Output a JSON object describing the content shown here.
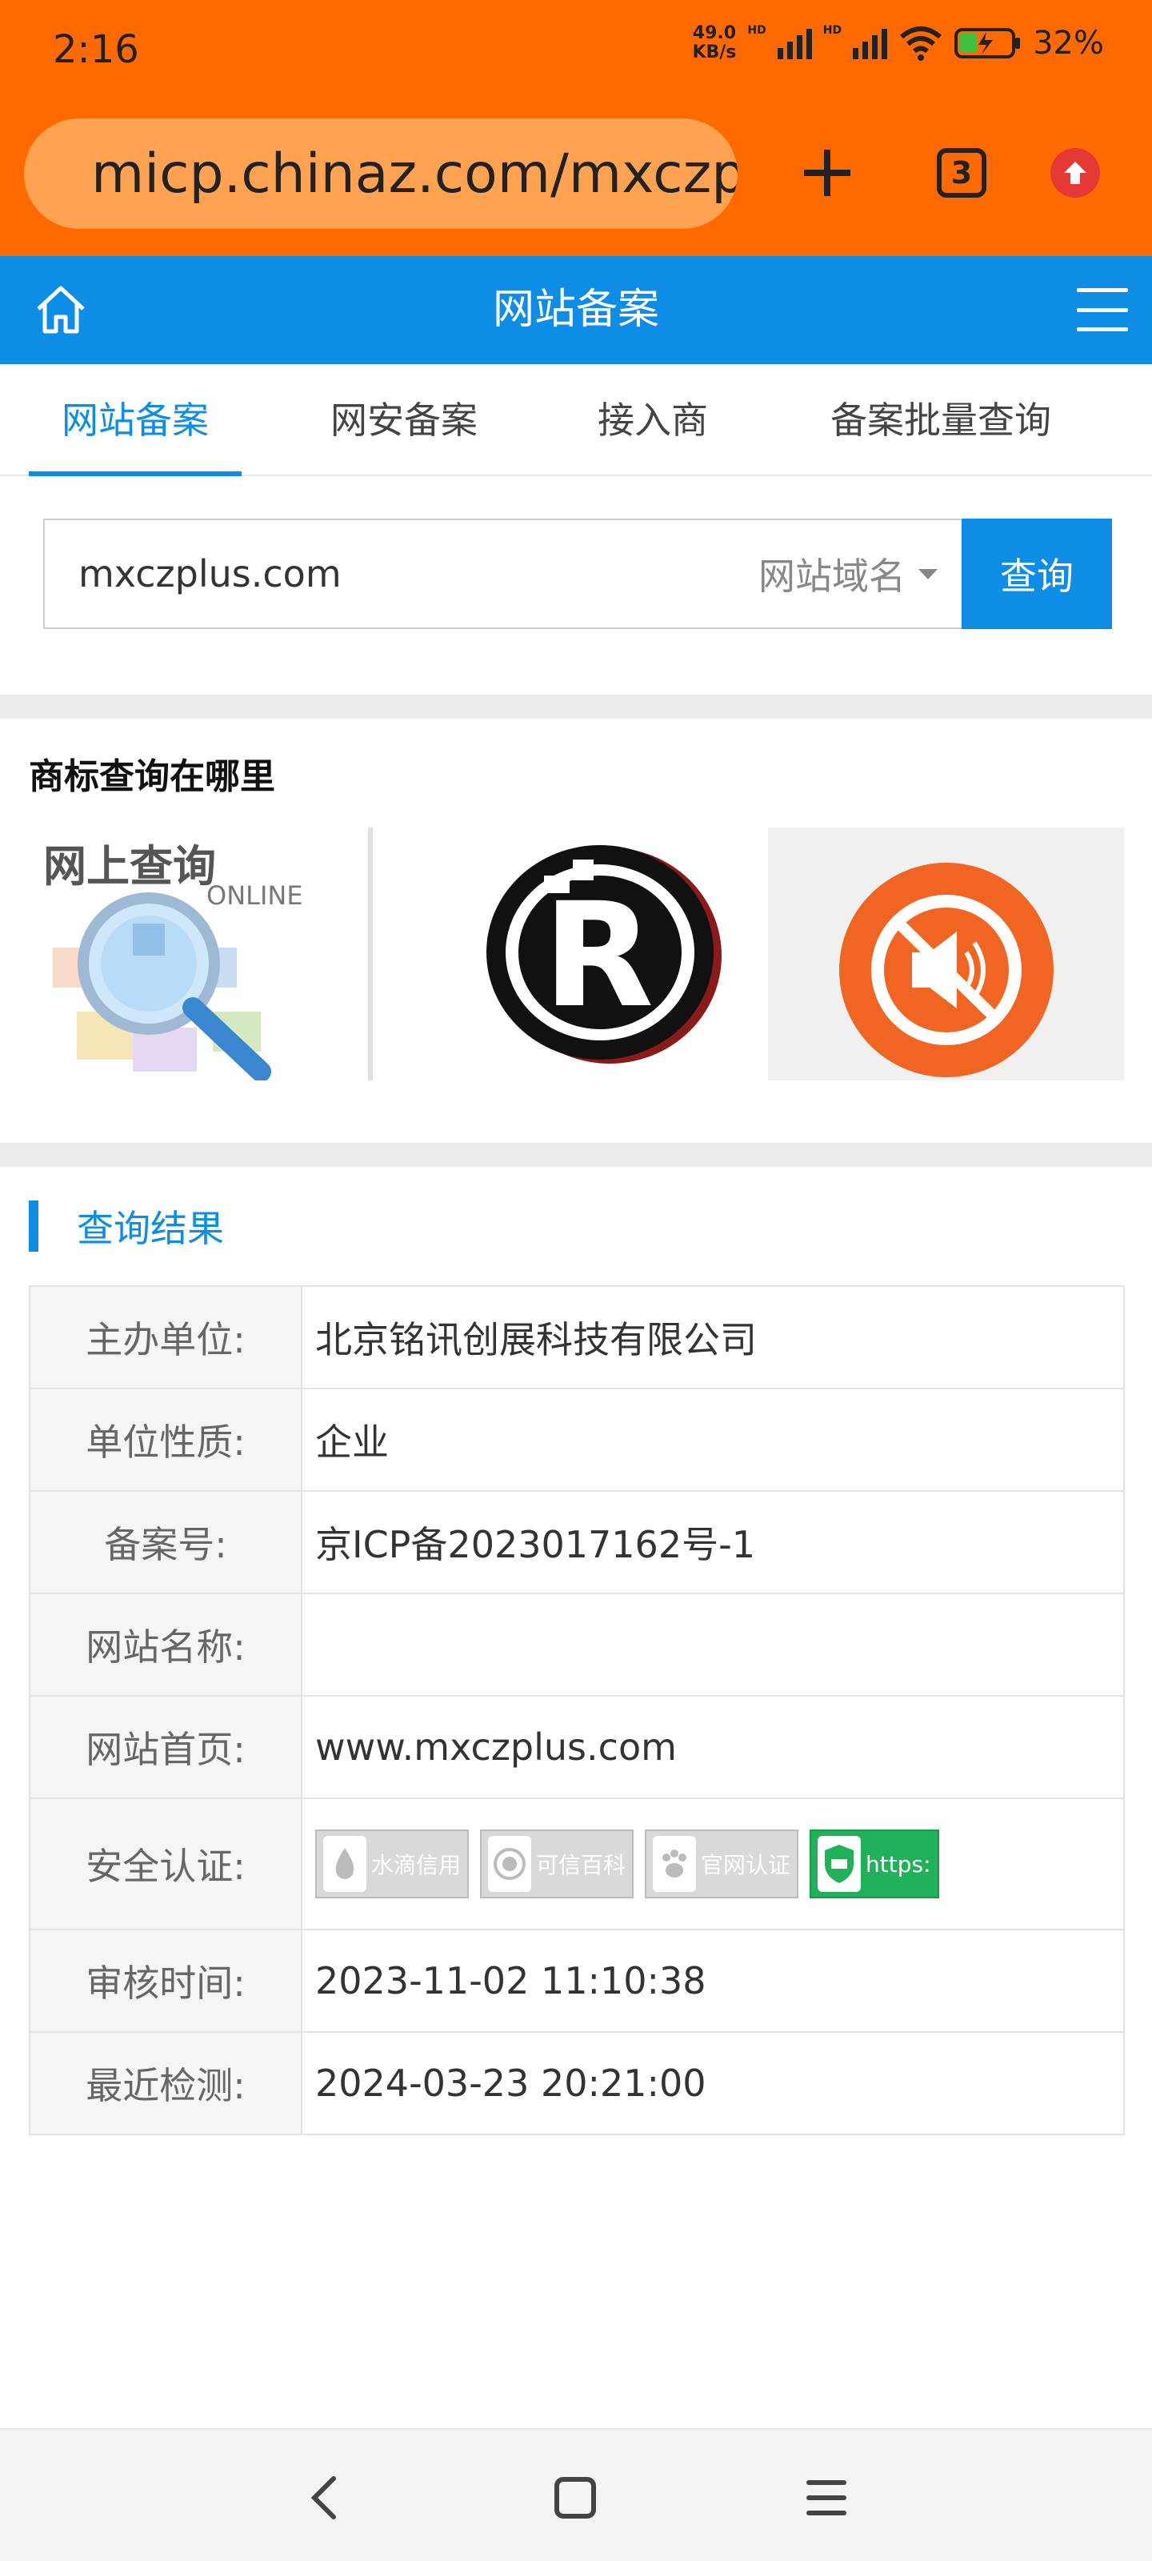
{
  "status_bar": {
    "time": "2:16",
    "net_speed_value": "49.0",
    "net_speed_unit": "KB/s",
    "hd_1": "HD",
    "hd_2": "HD",
    "battery_pct": "32%"
  },
  "browser": {
    "url": "micp.chinaz.com/mxczp",
    "tab_count": "3"
  },
  "site_header": {
    "title": "网站备案"
  },
  "tabs": [
    {
      "label": "网站备案",
      "active": true
    },
    {
      "label": "网安备案",
      "active": false
    },
    {
      "label": "接入商",
      "active": false
    },
    {
      "label": "备案批量查询",
      "active": false
    }
  ],
  "search": {
    "value": "mxczplus.com",
    "type_label": "网站域名",
    "button_label": "查询"
  },
  "ad": {
    "title": "商标查询在哪里",
    "banner_1_heading": "网上查询",
    "banner_1_sub": "ONLINE"
  },
  "result": {
    "title": "查询结果",
    "rows": [
      {
        "label": "主办单位:",
        "value": "北京铭讯创展科技有限公司"
      },
      {
        "label": "单位性质:",
        "value": "企业"
      },
      {
        "label": "备案号:",
        "value": "京ICP备2023017162号-1"
      },
      {
        "label": "网站名称:",
        "value": ""
      },
      {
        "label": "网站首页:",
        "value": "www.mxczplus.com"
      },
      {
        "label": "安全认证:",
        "value": ""
      },
      {
        "label": "审核时间:",
        "value": "2023-11-02 11:10:38"
      },
      {
        "label": "最近检测:",
        "value": "2024-03-23 20:21:00"
      }
    ],
    "badges": [
      {
        "label": "水滴信用",
        "icon": "water-drop-icon"
      },
      {
        "label": "可信百科",
        "icon": "seal-icon"
      },
      {
        "label": "官网认证",
        "icon": "paw-icon"
      },
      {
        "label": "https:",
        "icon": "ssl-shield-icon"
      }
    ]
  },
  "colors": {
    "chrome_orange": "#ff6a00",
    "brand_blue": "#0e8de6",
    "ssl_green": "#21b15a"
  }
}
